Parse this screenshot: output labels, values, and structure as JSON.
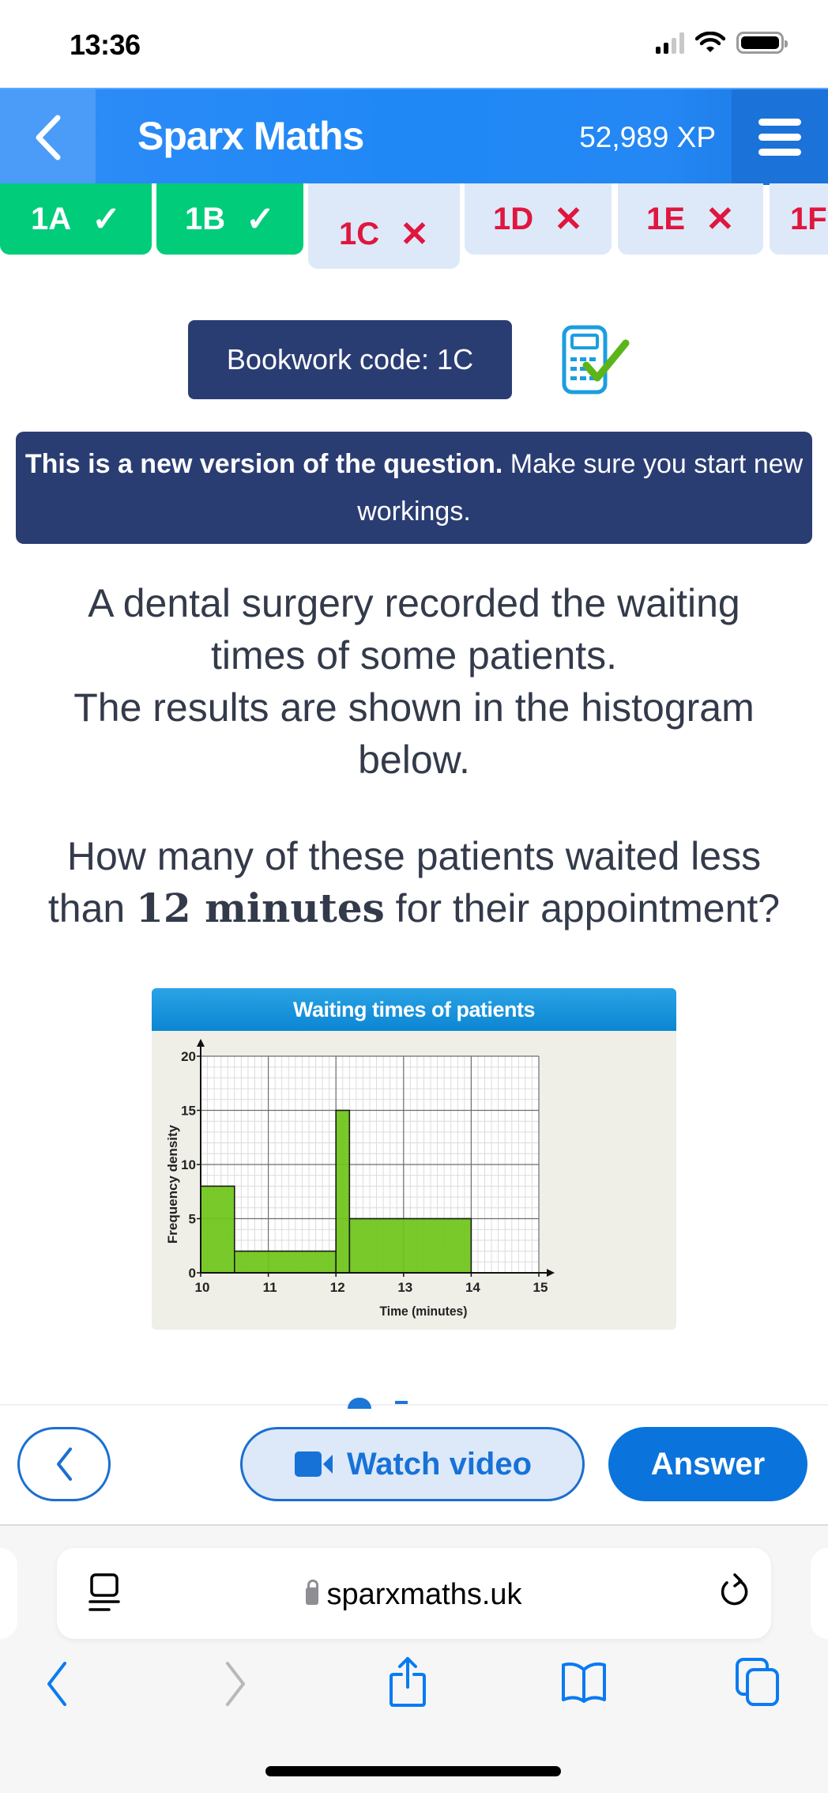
{
  "status_bar": {
    "time": "13:36",
    "icons": [
      "cellular-signal-icon",
      "wifi-icon",
      "battery-icon"
    ]
  },
  "header": {
    "back_icon": "chevron-left-icon",
    "title": "Sparx Maths",
    "xp": "52,989 XP",
    "menu_icon": "hamburger-menu-icon"
  },
  "tabs": [
    {
      "label": "1A",
      "status": "correct",
      "mark": "✓"
    },
    {
      "label": "1B",
      "status": "correct",
      "mark": "✓"
    },
    {
      "label": "1C",
      "status": "incorrect",
      "mark": "✕",
      "current": true
    },
    {
      "label": "1D",
      "status": "incorrect",
      "mark": "✕"
    },
    {
      "label": "1E",
      "status": "incorrect",
      "mark": "✕"
    },
    {
      "label": "1F",
      "status": "incorrect",
      "mark": ""
    }
  ],
  "bookwork": {
    "label": "Bookwork code: 1C",
    "icon": "calculator-allowed-icon"
  },
  "banner": {
    "bold": "This is a new version of the question.",
    "rest": " Make sure you start new workings."
  },
  "question": {
    "intro_lines": [
      "A dental surgery recorded the waiting",
      "times of some patients.",
      "The results are shown in the histogram",
      "below."
    ],
    "ask_line1": "How many of these patients waited less",
    "ask_pre": "than ",
    "ask_math": "12 minutes",
    "ask_post": " for their appointment?"
  },
  "chart_data": {
    "type": "bar",
    "subtype": "histogram",
    "title": "Waiting times of patients",
    "xlabel": "Time (minutes)",
    "ylabel": "Frequency density",
    "xlim": [
      10,
      15
    ],
    "ylim": [
      0,
      20
    ],
    "xticks": [
      10,
      11,
      12,
      13,
      14,
      15
    ],
    "yticks": [
      0,
      5,
      10,
      15,
      20
    ],
    "grid": true,
    "minor_grid": {
      "x_step": 0.1,
      "y_step": 1
    },
    "bins": [
      {
        "from": 10,
        "to": 10.5,
        "frequency_density": 8
      },
      {
        "from": 10.5,
        "to": 12,
        "frequency_density": 2
      },
      {
        "from": 12,
        "to": 12.2,
        "frequency_density": 15
      },
      {
        "from": 12.2,
        "to": 14,
        "frequency_density": 5
      }
    ],
    "bar_color": "#6cc417"
  },
  "actions": {
    "back_icon": "chevron-left-icon",
    "watch_video": "Watch video",
    "video_icon": "video-camera-icon",
    "answer": "Answer"
  },
  "browser": {
    "url": "sparxmaths.uk",
    "reader_icon": "reader-mode-icon",
    "lock_icon": "lock-icon",
    "reload_icon": "reload-icon",
    "toolbar": [
      "back-icon",
      "forward-icon",
      "share-icon",
      "bookmarks-icon",
      "tabs-icon"
    ]
  },
  "colors": {
    "primary_blue": "#1f88f5",
    "navy": "#2a3d73",
    "success_green": "#00cc7a",
    "error_red": "#e0163f",
    "tab_inactive_bg": "#dde9f8"
  }
}
